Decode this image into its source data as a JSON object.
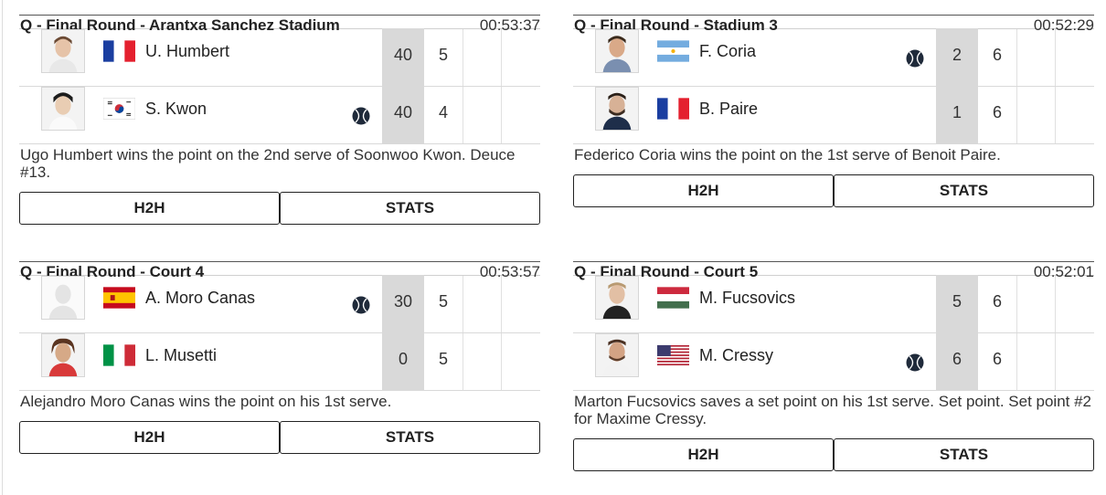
{
  "matches": [
    {
      "title": "Q - Final Round - Arantxa Sanchez Stadium",
      "time": "00:53:37",
      "players": [
        {
          "name": "U. Humbert",
          "flag": "France",
          "serving": false,
          "points": "40",
          "sets": [
            "5",
            ""
          ]
        },
        {
          "name": "S. Kwon",
          "flag": "South Korea",
          "serving": true,
          "points": "40",
          "sets": [
            "4",
            ""
          ]
        }
      ],
      "description": "Ugo Humbert wins the point on the 2nd serve of Soonwoo Kwon. Deuce #13.",
      "h2h_label": "H2H",
      "stats_label": "STATS"
    },
    {
      "title": "Q - Final Round - Stadium 3",
      "time": "00:52:29",
      "players": [
        {
          "name": "F. Coria",
          "flag": "Argentina",
          "serving": true,
          "points": "2",
          "sets": [
            "6",
            ""
          ]
        },
        {
          "name": "B. Paire",
          "flag": "France",
          "serving": false,
          "points": "1",
          "sets": [
            "6",
            ""
          ]
        }
      ],
      "description": "Federico Coria wins the point on the 1st serve of Benoit Paire.",
      "h2h_label": "H2H",
      "stats_label": "STATS"
    },
    {
      "title": "Q - Final Round - Court 4",
      "time": "00:53:57",
      "players": [
        {
          "name": "A. Moro Canas",
          "flag": "Spain",
          "serving": true,
          "points": "30",
          "sets": [
            "5",
            ""
          ]
        },
        {
          "name": "L. Musetti",
          "flag": "Italy",
          "serving": false,
          "points": "0",
          "sets": [
            "5",
            ""
          ]
        }
      ],
      "description": "Alejandro Moro Canas wins the point on his 1st serve.",
      "h2h_label": "H2H",
      "stats_label": "STATS"
    },
    {
      "title": "Q - Final Round - Court 5",
      "time": "00:52:01",
      "players": [
        {
          "name": "M. Fucsovics",
          "flag": "Hungary",
          "serving": false,
          "points": "5",
          "sets": [
            "6",
            ""
          ]
        },
        {
          "name": "M. Cressy",
          "flag": "USA",
          "serving": true,
          "points": "6",
          "sets": [
            "6",
            ""
          ]
        }
      ],
      "description": "Marton Fucsovics saves a set point on his 1st serve. Set point. Set point #2 for Maxime Cressy.",
      "h2h_label": "H2H",
      "stats_label": "STATS"
    }
  ],
  "icons": {
    "serve": "tennis-ball-icon",
    "photo": "player-photo"
  },
  "colors": {
    "score_bg": "#d9d9d9",
    "serve_ball": "#1f2a3a",
    "button_border": "#222222"
  }
}
